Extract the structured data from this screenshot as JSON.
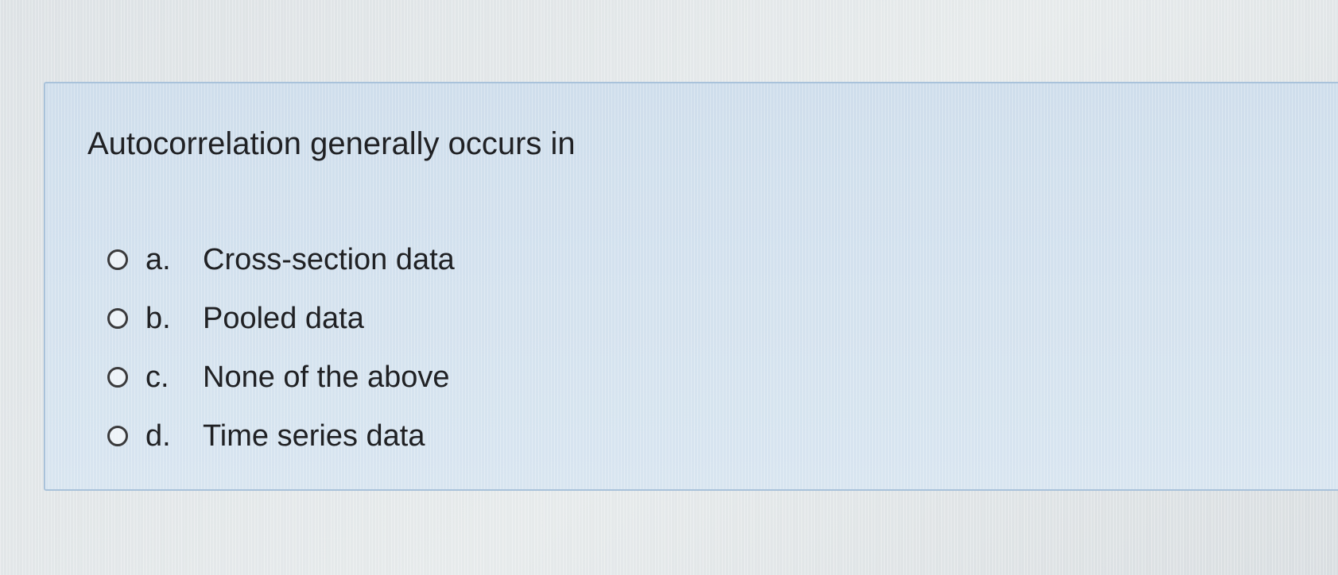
{
  "question": {
    "text": "Autocorrelation generally occurs in"
  },
  "options": [
    {
      "letter": "a.",
      "text": "Cross-section data",
      "selected": false
    },
    {
      "letter": "b.",
      "text": "Pooled data",
      "selected": false
    },
    {
      "letter": "c.",
      "text": "None of the above",
      "selected": false
    },
    {
      "letter": "d.",
      "text": "Time series data",
      "selected": false
    }
  ],
  "colors": {
    "card_background": "#d3e2ef",
    "card_border": "#a9c2da",
    "page_background": "#e2e6e8",
    "text": "#202124"
  }
}
